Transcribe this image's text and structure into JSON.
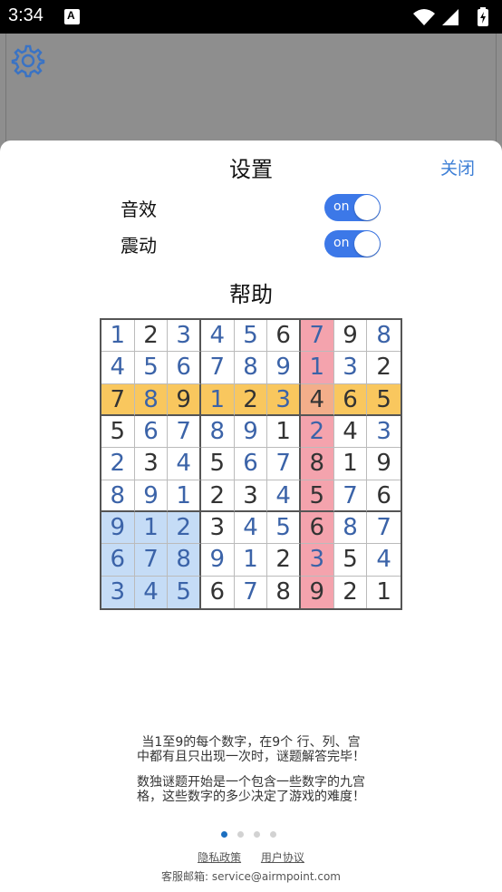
{
  "status_bar": {
    "time": "3:34",
    "notification_badge": "A"
  },
  "settings": {
    "title": "设置",
    "close_label": "关闭",
    "rows": [
      {
        "label": "音效",
        "toggle_text": "on",
        "on": true
      },
      {
        "label": "震动",
        "toggle_text": "on",
        "on": true
      }
    ]
  },
  "help": {
    "title": "帮助",
    "grid": [
      [
        "1",
        "2",
        "3",
        "4",
        "5",
        "6",
        "7",
        "9",
        "8"
      ],
      [
        "4",
        "5",
        "6",
        "7",
        "8",
        "9",
        "1",
        "3",
        "2"
      ],
      [
        "7",
        "8",
        "9",
        "1",
        "2",
        "3",
        "4",
        "6",
        "5"
      ],
      [
        "5",
        "6",
        "7",
        "8",
        "9",
        "1",
        "2",
        "4",
        "3"
      ],
      [
        "2",
        "3",
        "4",
        "5",
        "6",
        "7",
        "8",
        "1",
        "9"
      ],
      [
        "8",
        "9",
        "1",
        "2",
        "3",
        "4",
        "5",
        "7",
        "6"
      ],
      [
        "9",
        "1",
        "2",
        "3",
        "4",
        "5",
        "6",
        "8",
        "7"
      ],
      [
        "6",
        "7",
        "8",
        "9",
        "1",
        "2",
        "3",
        "5",
        "4"
      ],
      [
        "3",
        "4",
        "5",
        "6",
        "7",
        "8",
        "9",
        "2",
        "1"
      ]
    ],
    "given_cells": [
      [
        0,
        1
      ],
      [
        0,
        5
      ],
      [
        0,
        7
      ],
      [
        1,
        8
      ],
      [
        2,
        0
      ],
      [
        2,
        2
      ],
      [
        2,
        4
      ],
      [
        2,
        6
      ],
      [
        2,
        7
      ],
      [
        2,
        8
      ],
      [
        3,
        0
      ],
      [
        3,
        5
      ],
      [
        3,
        7
      ],
      [
        4,
        1
      ],
      [
        4,
        3
      ],
      [
        4,
        6
      ],
      [
        4,
        7
      ],
      [
        4,
        8
      ],
      [
        5,
        3
      ],
      [
        5,
        4
      ],
      [
        5,
        6
      ],
      [
        5,
        8
      ],
      [
        6,
        3
      ],
      [
        6,
        6
      ],
      [
        7,
        5
      ],
      [
        7,
        7
      ],
      [
        8,
        3
      ],
      [
        8,
        5
      ],
      [
        8,
        6
      ],
      [
        8,
        7
      ],
      [
        8,
        8
      ]
    ],
    "highlight_row": 2,
    "highlight_col": 6,
    "highlight_box": [
      2,
      0
    ],
    "colors": {
      "row_highlight": "#f9c75e",
      "col_highlight": "#f4a3ad",
      "intersection": "#f3ae8a",
      "box_highlight": "#c5dcf6",
      "given_digit": "#333333",
      "entered_digit": "#3b63a8"
    },
    "description_1": [
      "当1至9的每个数字，在9个 行、列、宫",
      "中都有且只出现一次时，谜题解答完毕！"
    ],
    "description_2": [
      "数独谜题开始是一个包含一些数字的九宫",
      "格，这些数字的多少决定了游戏的难度！"
    ],
    "page_count": 4,
    "active_page": 0
  },
  "footer": {
    "privacy_label": "隐私政策",
    "agreement_label": "用户协议",
    "email_text": "客服邮箱: service@airmpoint.com"
  }
}
